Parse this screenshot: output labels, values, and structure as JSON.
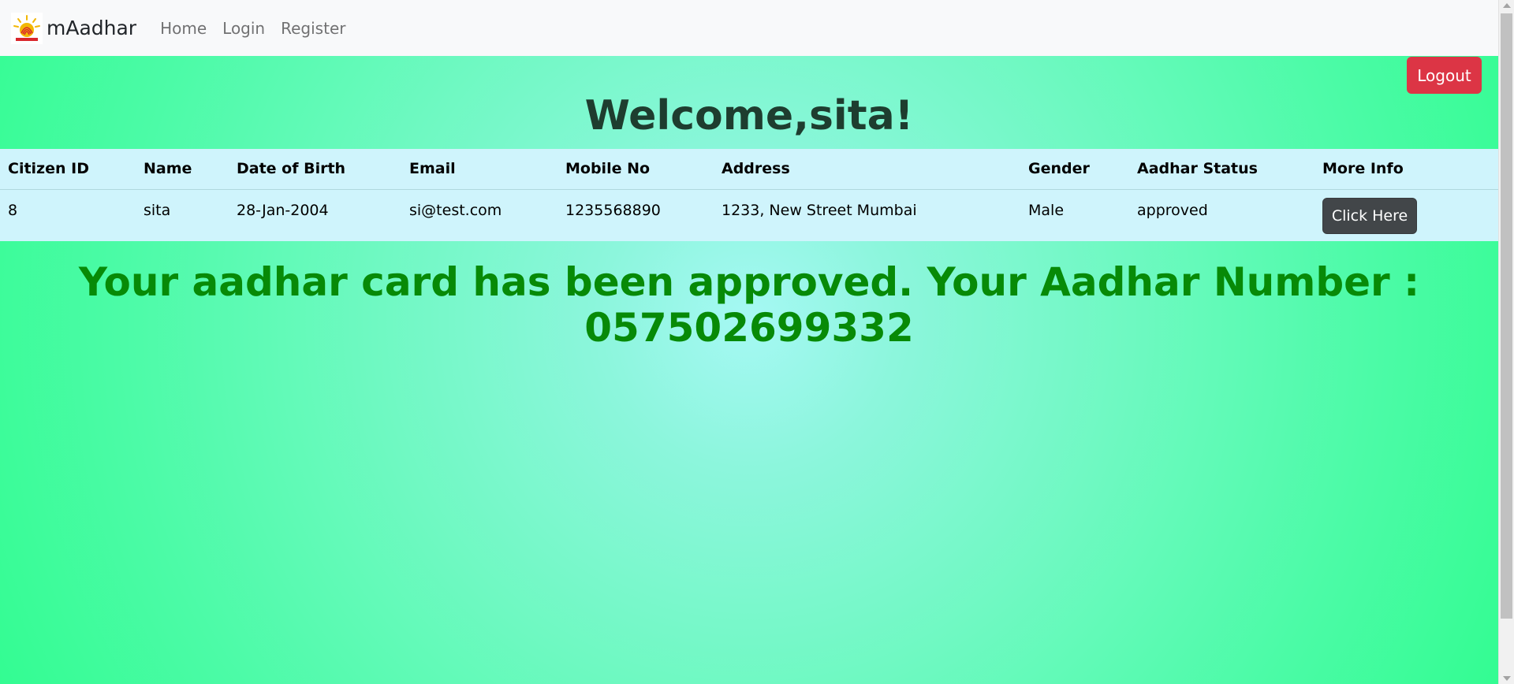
{
  "navbar": {
    "brand": "mAadhar",
    "links": [
      {
        "label": "Home"
      },
      {
        "label": "Login"
      },
      {
        "label": "Register"
      }
    ]
  },
  "logout_label": "Logout",
  "welcome_text": "Welcome,sita!",
  "table": {
    "headers": [
      "Citizen ID",
      "Name",
      "Date of Birth",
      "Email",
      "Mobile No",
      "Address",
      "Gender",
      "Aadhar Status",
      "More Info"
    ],
    "rows": [
      {
        "citizen_id": "8",
        "name": "sita",
        "dob": "28-Jan-2004",
        "email": "si@test.com",
        "mobile": "1235568890",
        "address": "1233, New Street Mumbai",
        "gender": "Male",
        "status": "approved",
        "more_info_label": "Click Here"
      }
    ]
  },
  "approval_message": "Your aadhar card has been approved. Your Aadhar Number : 057502699332",
  "colors": {
    "logout": "#dc3545",
    "info_button": "#424649",
    "table_bg": "#cff4fc",
    "message": "#078a07"
  },
  "icons": {
    "brand_logo": "aadhaar-logo-icon"
  }
}
